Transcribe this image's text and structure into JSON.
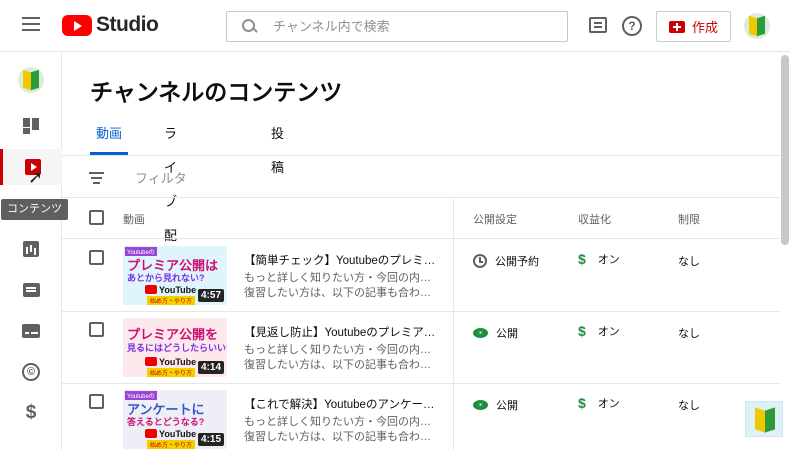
{
  "header": {
    "logo_text": "Studio",
    "search_placeholder": "チャンネル内で検索",
    "create_label": "作成",
    "help_glyph": "?"
  },
  "sidebar": {
    "items": [
      {
        "name": "dashboard",
        "icon": "dashboard-icon"
      },
      {
        "name": "content",
        "icon": "content-icon",
        "active": true
      },
      {
        "name": "analytics",
        "icon": "analytics-icon"
      },
      {
        "name": "comments",
        "icon": "comments-icon"
      },
      {
        "name": "subtitles",
        "icon": "subtitles-icon"
      },
      {
        "name": "copyright",
        "icon": "copyright-icon"
      },
      {
        "name": "monetization",
        "icon": "dollar-icon"
      }
    ],
    "tooltip": "コンテンツ",
    "copyright_glyph": "©",
    "money_glyph": "$"
  },
  "page": {
    "title": "チャンネルのコンテンツ",
    "tabs": [
      {
        "label": "動画",
        "active": true
      },
      {
        "label": "ライブ配信"
      },
      {
        "label": "投稿"
      }
    ],
    "filter_label": "フィルタ"
  },
  "table": {
    "headers": {
      "video": "動画",
      "visibility": "公開設定",
      "monetization": "収益化",
      "restrictions": "制限"
    },
    "rows": [
      {
        "title": "【簡単チェック】Youtubeのプレミア公開はあとから見れない?",
        "desc1": "もっと詳しく知りたい方・今回の内容を",
        "desc2": "復習したい方は、以下の記事も合わせてご覧ください",
        "visibility": "公開予約",
        "visibility_icon": "clock-icon",
        "monetization": "オン",
        "restrictions": "なし",
        "duration": "4:57",
        "thumb": {
          "tag": "Youtubeの",
          "main": "プレミア公開は",
          "sub": "あとから見れない?",
          "yt": "YouTube",
          "badge": "始め方・やり方",
          "bg": "#dff4fb"
        }
      },
      {
        "title": "【見返し防止】Youtubeのプレミア公開を見るにはどうしたらいい?",
        "desc1": "もっと詳しく知りたい方・今回の内容を",
        "desc2": "復習したい方は、以下の記事も合わせてご覧ください",
        "visibility": "公開",
        "visibility_icon": "eye-icon",
        "monetization": "オン",
        "restrictions": "なし",
        "duration": "4:14",
        "thumb": {
          "tag": "",
          "main": "プレミア公開を",
          "sub": "見るにはどうしたらいい?",
          "yt": "YouTube",
          "badge": "始め方・やり方",
          "bg": "#fde8ec"
        }
      },
      {
        "title": "【これで解決】Youtubeのアンケートに答えるとどうなる?",
        "desc1": "もっと詳しく知りたい方・今回の内容を",
        "desc2": "復習したい方は、以下の記事も合わせてご覧ください",
        "visibility": "公開",
        "visibility_icon": "eye-icon",
        "monetization": "オン",
        "restrictions": "なし",
        "duration": "4:15",
        "thumb": {
          "tag": "Youtubeの",
          "main": "アンケートに",
          "sub": "答えるとどうなる?",
          "yt": "YouTube",
          "badge": "始め方・やり方",
          "bg": "#eeeef6"
        }
      }
    ]
  },
  "colors": {
    "accent_blue": "#065fd4",
    "brand_red": "#ff0000",
    "status_green": "#1e8e3e"
  }
}
